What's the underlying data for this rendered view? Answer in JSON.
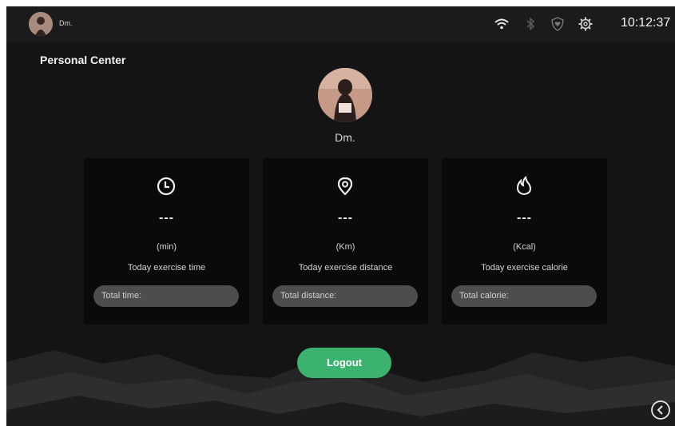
{
  "status_bar": {
    "user_name": "Dm.",
    "time": "10:12:37",
    "icons": [
      "wifi-icon",
      "bluetooth-icon",
      "shield-heart-icon",
      "settings-icon"
    ]
  },
  "page": {
    "title": "Personal Center",
    "user_name": "Dm."
  },
  "cards": [
    {
      "icon": "clock-icon",
      "value": "---",
      "unit": "(min)",
      "caption": "Today exercise time",
      "total_label": "Total time:"
    },
    {
      "icon": "location-pin-icon",
      "value": "---",
      "unit": "(Km)",
      "caption": "Today exercise distance",
      "total_label": "Total distance:"
    },
    {
      "icon": "flame-icon",
      "value": "---",
      "unit": "(Kcal)",
      "caption": "Today exercise calorie",
      "total_label": "Total calorie:"
    }
  ],
  "actions": {
    "logout_label": "Logout"
  },
  "colors": {
    "background": "#141414",
    "card": "#0a0a0a",
    "accent_green": "#3bb36f",
    "pill": "#4d4d4d"
  }
}
